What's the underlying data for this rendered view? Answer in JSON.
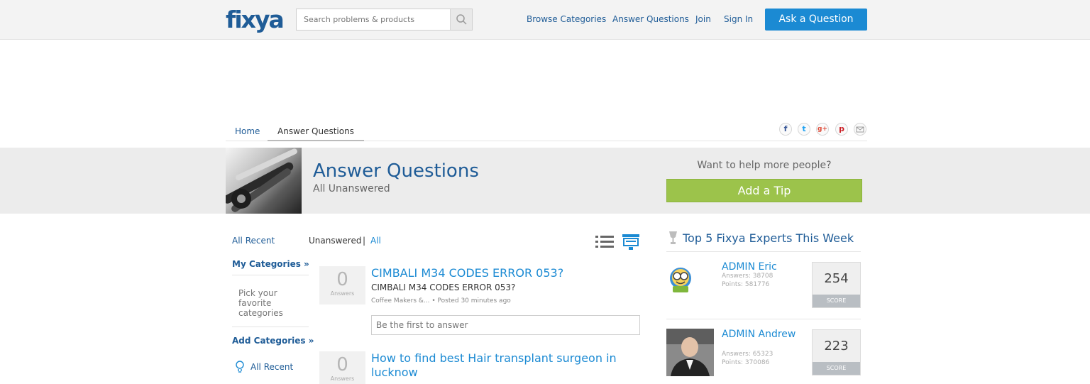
{
  "header": {
    "logo": "fixya",
    "search_placeholder": "Search problems & products",
    "nav": [
      "Browse Categories",
      "Answer Questions",
      "Join",
      "Sign In"
    ],
    "ask_button": "Ask a Question"
  },
  "breadcrumb": {
    "home": "Home",
    "current": "Answer Questions"
  },
  "share_icons": [
    "facebook-icon",
    "twitter-icon",
    "google-plus-icon",
    "pinterest-icon",
    "email-icon"
  ],
  "page": {
    "title": "Answer Questions",
    "subtitle": "All Unanswered",
    "help_prompt": "Want to help more people?",
    "tip_button": "Add a Tip"
  },
  "left_sidebar": {
    "all_recent": "All Recent",
    "my_categories": "My Categories »",
    "pick_text": "Pick your favorite categories",
    "add_categories": "Add Categories »",
    "all_recent_2": "All Recent"
  },
  "filters": {
    "unanswered": "Unanswered",
    "separator": "|",
    "all": "All"
  },
  "questions": [
    {
      "answers": "0",
      "answers_label": "Answers",
      "title": "CIMBALI M34 CODES ERROR 053?",
      "body": "CIMBALI M34 CODES ERROR 053?",
      "meta": "Coffee Makers &... • Posted 30 minutes ago",
      "answer_placeholder": "Be the first to answer"
    },
    {
      "answers": "0",
      "answers_label": "Answers",
      "title": "How to find best Hair transplant surgeon in lucknow"
    }
  ],
  "experts": {
    "heading": "Top 5 Fixya Experts This Week",
    "items": [
      {
        "name": "ADMIN Eric",
        "answers": "Answers: 38708",
        "points": "Points: 581776",
        "score": "254",
        "score_label": "SCORE"
      },
      {
        "name": "ADMIN Andrew",
        "answers": "Answers: 65323",
        "points": "Points: 370086",
        "score": "223",
        "score_label": "SCORE"
      }
    ]
  },
  "colors": {
    "brand_blue": "#1f5c97",
    "link_blue": "#1b8ad3",
    "tip_green": "#9cc34b"
  }
}
